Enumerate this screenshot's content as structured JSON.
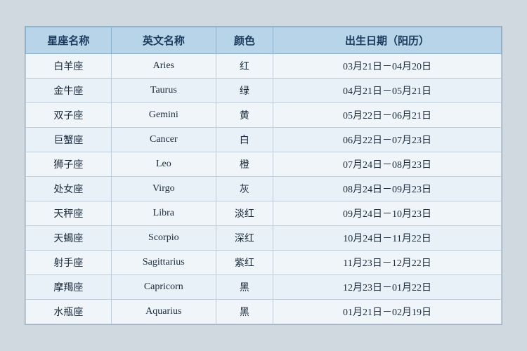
{
  "table": {
    "headers": [
      {
        "key": "chinese_name",
        "label": "星座名称"
      },
      {
        "key": "english_name",
        "label": "英文名称"
      },
      {
        "key": "color",
        "label": "颜色"
      },
      {
        "key": "date_range",
        "label": "出生日期（阳历）"
      }
    ],
    "rows": [
      {
        "chinese": "白羊座",
        "english": "Aries",
        "color": "红",
        "date": "03月21日－04月20日"
      },
      {
        "chinese": "金牛座",
        "english": "Taurus",
        "color": "绿",
        "date": "04月21日－05月21日"
      },
      {
        "chinese": "双子座",
        "english": "Gemini",
        "color": "黄",
        "date": "05月22日－06月21日"
      },
      {
        "chinese": "巨蟹座",
        "english": "Cancer",
        "color": "白",
        "date": "06月22日－07月23日"
      },
      {
        "chinese": "狮子座",
        "english": "Leo",
        "color": "橙",
        "date": "07月24日－08月23日"
      },
      {
        "chinese": "处女座",
        "english": "Virgo",
        "color": "灰",
        "date": "08月24日－09月23日"
      },
      {
        "chinese": "天秤座",
        "english": "Libra",
        "color": "淡红",
        "date": "09月24日－10月23日"
      },
      {
        "chinese": "天蝎座",
        "english": "Scorpio",
        "color": "深红",
        "date": "10月24日－11月22日"
      },
      {
        "chinese": "射手座",
        "english": "Sagittarius",
        "color": "紫红",
        "date": "11月23日－12月22日"
      },
      {
        "chinese": "摩羯座",
        "english": "Capricorn",
        "color": "黑",
        "date": "12月23日－01月22日"
      },
      {
        "chinese": "水瓶座",
        "english": "Aquarius",
        "color": "黑",
        "date": "01月21日－02月19日"
      }
    ]
  }
}
